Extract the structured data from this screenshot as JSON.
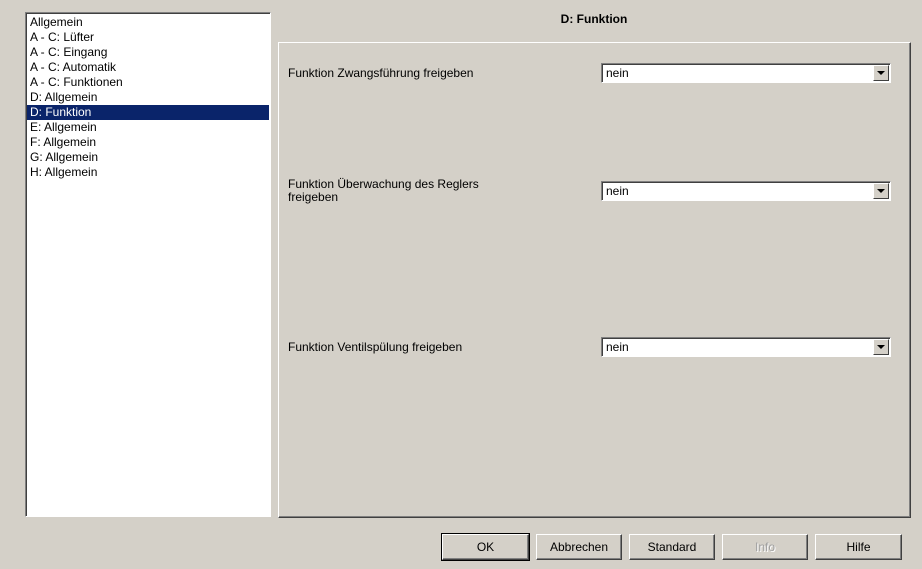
{
  "nav": {
    "items": [
      {
        "label": "Allgemein"
      },
      {
        "label": "A - C: Lüfter"
      },
      {
        "label": "A - C: Eingang"
      },
      {
        "label": "A - C: Automatik"
      },
      {
        "label": "A - C: Funktionen"
      },
      {
        "label": "D: Allgemein"
      },
      {
        "label": "D: Funktion"
      },
      {
        "label": "E: Allgemein"
      },
      {
        "label": "F: Allgemein"
      },
      {
        "label": "G: Allgemein"
      },
      {
        "label": "H: Allgemein"
      }
    ],
    "selected": "D: Funktion"
  },
  "panel": {
    "title": "D: Funktion",
    "params": [
      {
        "label": "Funktion Zwangsführung freigeben",
        "value": "nein"
      },
      {
        "label_line1": "Funktion Überwachung des Reglers",
        "label_line2": "freigeben",
        "value": "nein"
      },
      {
        "label": "Funktion Ventilspülung freigeben",
        "value": "nein"
      }
    ]
  },
  "buttons": {
    "ok": "OK",
    "cancel": "Abbrechen",
    "standard": "Standard",
    "info": "Info",
    "help": "Hilfe"
  }
}
